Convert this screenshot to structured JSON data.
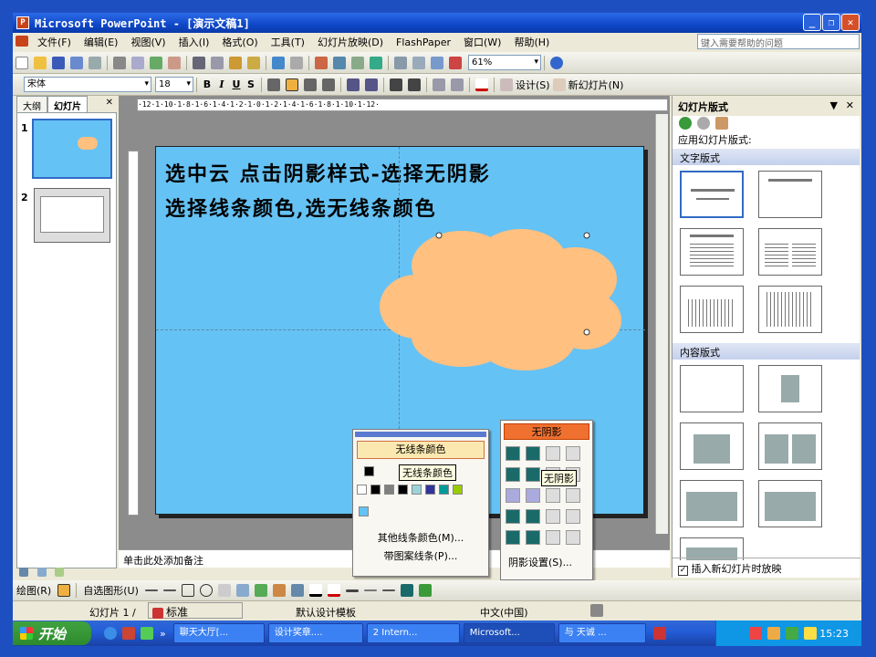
{
  "window": {
    "title": "Microsoft PowerPoint - [演示文稿1]",
    "minimize_glyph": "_",
    "restore_glyph": "❐",
    "close_glyph": "✕"
  },
  "menu": {
    "items": [
      "文件(F)",
      "编辑(E)",
      "视图(V)",
      "插入(I)",
      "格式(O)",
      "工具(T)",
      "幻灯片放映(D)",
      "FlashPaper",
      "窗口(W)",
      "帮助(H)"
    ],
    "help_placeholder": "键入需要帮助的问题"
  },
  "toolbar": {
    "zoom": "61%",
    "font": "宋体",
    "font_size": "18",
    "design_label": "设计(S)",
    "new_slide_label": "新幻灯片(N)",
    "bold": "B",
    "italic": "I",
    "underline": "U",
    "shadow": "S"
  },
  "outline": {
    "tab_outline": "大纲",
    "tab_slides": "幻灯片",
    "slide1_num": "1",
    "slide2_num": "2"
  },
  "ruler": {
    "text": "·12·1·10·1·8·1·6·1·4·1·2·1·0·1·2·1·4·1·6·1·8·1·10·1·12·"
  },
  "slide": {
    "line1": "选中云 点击阴影样式-选择无阴影",
    "line2": "选择线条颜色,选无线条颜色",
    "bg_color": "#65c2f4",
    "cloud_color": "#ffc080"
  },
  "notes": {
    "placeholder": "单击此处添加备注"
  },
  "line_color_popup": {
    "no_line": "无线条颜色",
    "tooltip": "无线条颜色",
    "more_colors": "其他线条颜色(M)...",
    "patterned": "带图案线条(P)..."
  },
  "shadow_popup": {
    "no_shadow": "无阴影",
    "tooltip": "无阴影",
    "settings": "阴影设置(S)..."
  },
  "task_pane": {
    "title": "幻灯片版式",
    "apply_label": "应用幻灯片版式:",
    "section_text": "文字版式",
    "section_content": "内容版式",
    "checkbox_label": "插入新幻灯片时放映"
  },
  "drawing_toolbar": {
    "draw_label": "绘图(R)",
    "autoshapes_label": "自选图形(U)"
  },
  "status": {
    "slide_label": "幻灯片 1 /",
    "ime": "标准",
    "template": "默认设计模板",
    "language": "中文(中国)"
  },
  "taskbar": {
    "start": "开始",
    "tasks": [
      "聊天大厅[...",
      "设计奖章....",
      "2 Intern...",
      "Microsoft...",
      "与 天诚 ..."
    ],
    "time": "15:23"
  }
}
